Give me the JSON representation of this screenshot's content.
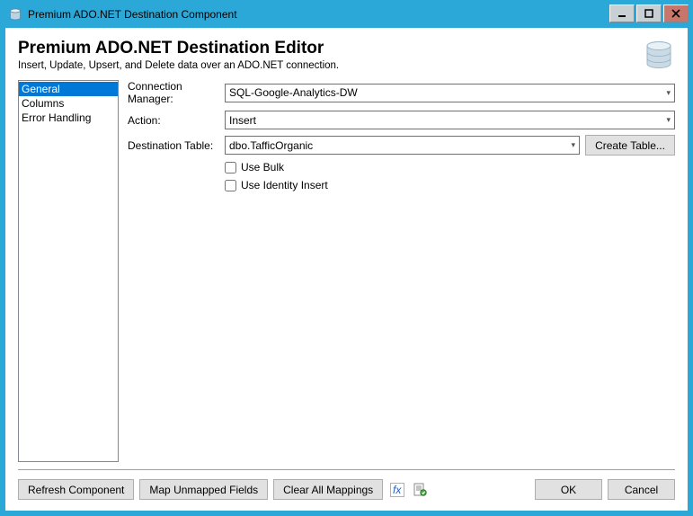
{
  "window": {
    "title": "Premium ADO.NET Destination Component"
  },
  "header": {
    "title": "Premium ADO.NET Destination Editor",
    "subtitle": "Insert, Update, Upsert, and Delete data over an ADO.NET connection."
  },
  "nav": {
    "items": [
      {
        "label": "General",
        "selected": true
      },
      {
        "label": "Columns",
        "selected": false
      },
      {
        "label": "Error Handling",
        "selected": false
      }
    ]
  },
  "form": {
    "connection_label": "Connection Manager:",
    "connection_value": "SQL-Google-Analytics-DW",
    "action_label": "Action:",
    "action_value": "Insert",
    "destination_label": "Destination Table:",
    "destination_value": "dbo.TafficOrganic",
    "create_table_label": "Create Table...",
    "use_bulk_label": "Use Bulk",
    "use_bulk_checked": false,
    "use_identity_label": "Use Identity Insert",
    "use_identity_checked": false
  },
  "footer": {
    "refresh_label": "Refresh Component",
    "map_label": "Map Unmapped Fields",
    "clear_label": "Clear All Mappings",
    "ok_label": "OK",
    "cancel_label": "Cancel"
  }
}
